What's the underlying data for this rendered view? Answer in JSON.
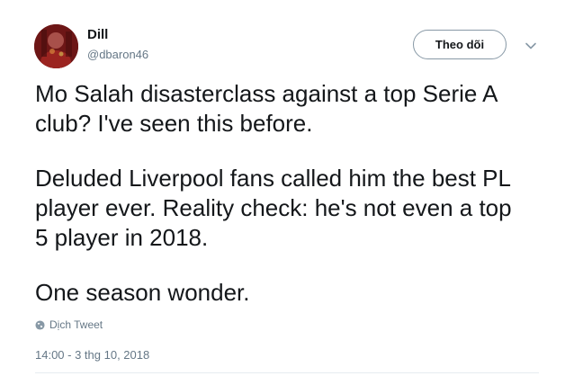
{
  "author": {
    "display_name": "Dill",
    "screen_name": "@dbaron46",
    "avatar_icon": "profile-photo"
  },
  "actions": {
    "follow_label": "Theo dõi",
    "more_icon": "chevron-down-icon"
  },
  "tweet": {
    "paragraphs": [
      [
        "Mo Salah disasterclass against a top Serie A",
        "club? I've seen this before."
      ],
      [
        "Deluded Liverpool fans called him the best PL",
        "player ever. Reality check: he's not even a top",
        "5 player in 2018."
      ],
      [
        "One season wonder."
      ]
    ]
  },
  "translate": {
    "label": "Dịch Tweet",
    "icon": "globe-icon"
  },
  "timestamp": "14:00 - 3 thg 10, 2018",
  "colors": {
    "primary_text": "#14171a",
    "secondary_text": "#657786",
    "button_border": "#8899a6",
    "divider": "#e6ecf0"
  }
}
